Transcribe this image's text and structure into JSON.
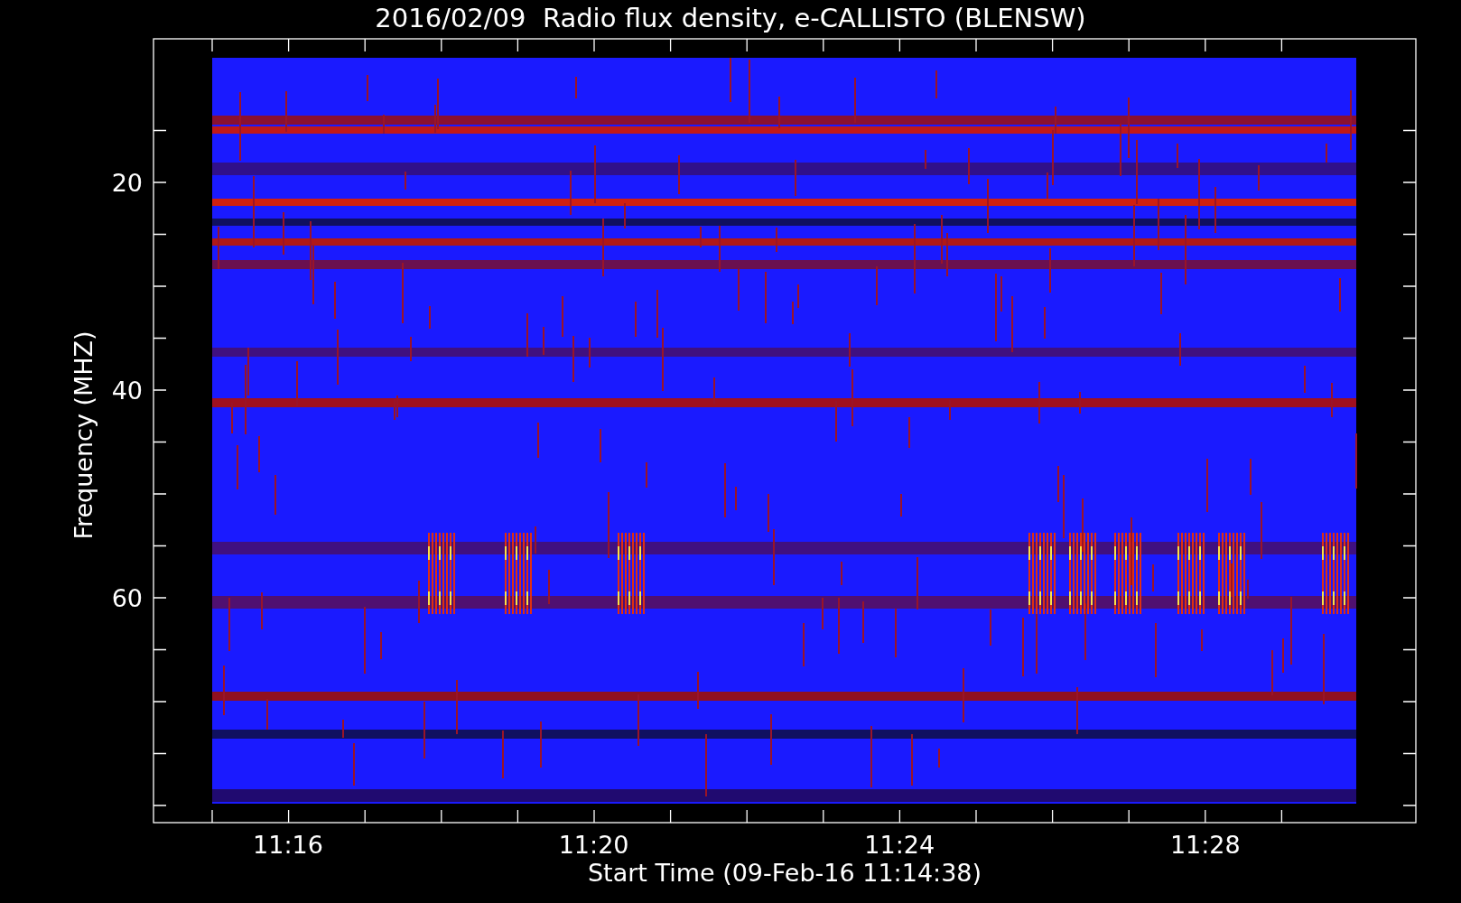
{
  "title": "2016/02/09  Radio flux density, e-CALLISTO (BLENSW)",
  "y_axis": {
    "label": "Frequency (MHZ)",
    "ticks": [
      "20",
      "40",
      "60"
    ]
  },
  "x_axis": {
    "label": "Start Time (09-Feb-16 11:14:38)",
    "ticks": [
      "11:16",
      "11:20",
      "11:24",
      "11:28"
    ]
  }
}
